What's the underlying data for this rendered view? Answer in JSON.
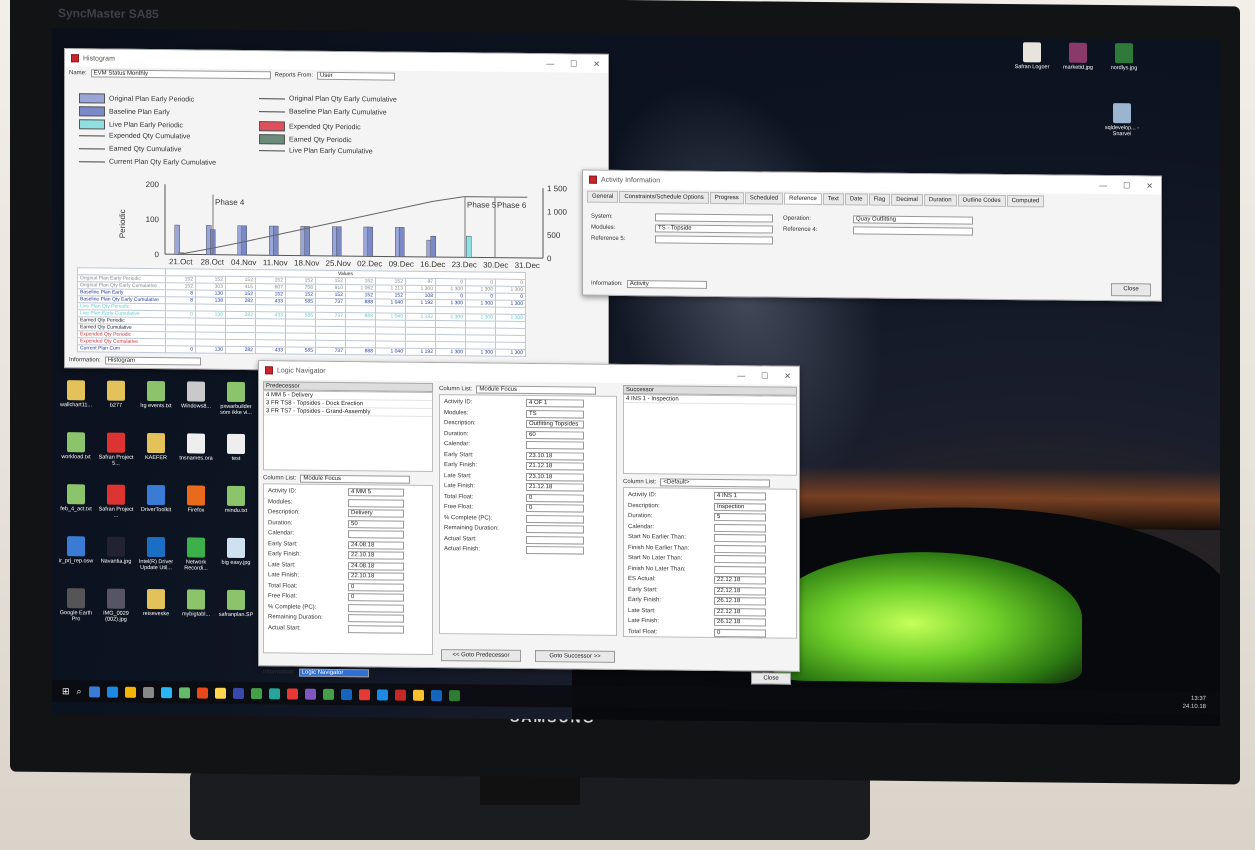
{
  "monitor": {
    "brand": "SyncMaster SA85",
    "maker": "SAMSUNG"
  },
  "histogram": {
    "title": "Histogram",
    "name_label": "Name:",
    "name_value": "EVM Status Monthly",
    "reports_from_label": "Reports From:",
    "reports_from_value": "User",
    "legend": [
      "Original Plan Early Periodic",
      "Baseline Plan Early",
      "Live Plan Early Periodic",
      "Expended Qty Cumulative",
      "Earned Qty Cumulative",
      "Current Plan Qty Early Cumulative",
      "Original Plan Qty Early Cumulative",
      "Baseline Plan Early Cumulative",
      "Expended Qty Periodic",
      "Earned Qty Periodic",
      "Live Plan Early Cumulative"
    ],
    "y_left_label": "Periodic",
    "y_right_label": "Cumulative",
    "phase_labels": [
      "Phase 4",
      "Phase 5",
      "Phase 6"
    ],
    "y_left_ticks": [
      "200",
      "100",
      "0"
    ],
    "y_right_ticks": [
      "1 500",
      "1 000",
      "500",
      "0"
    ],
    "values_header": "Values",
    "table_rows": [
      "Original Plan Early Periodic",
      "Original Plan Qty Early Cumulative",
      "Baseline Plan Early",
      "Baseline Plan Qty Early Cumulative",
      "Live Plan Qty Periodic",
      "Live Plan Early Cumulative",
      "Earned Qty Periodic",
      "Earned Qty Cumulative",
      "Expended Qty Periodic",
      "Expended Qty Cumulative",
      "Current Plan Cum"
    ],
    "table_values": [
      [
        "152",
        "152",
        "152",
        "152",
        "152",
        "152",
        "152",
        "152",
        "87",
        "0",
        "0",
        "0"
      ],
      [
        "152",
        "303",
        "415",
        "607",
        "758",
        "910",
        "1 062",
        "1 213",
        "1 300",
        "1 300",
        "1 300",
        "1 300"
      ],
      [
        "8",
        "130",
        "152",
        "152",
        "152",
        "152",
        "152",
        "152",
        "108",
        "0",
        "0",
        "0"
      ],
      [
        "8",
        "138",
        "282",
        "433",
        "585",
        "737",
        "888",
        "1 040",
        "1 192",
        "1 300",
        "1 300",
        "1 300"
      ],
      [
        "",
        "",
        "",
        "",
        "",
        "",
        "",
        "",
        "",
        "",
        "",
        ""
      ],
      [
        "0",
        "130",
        "282",
        "433",
        "585",
        "737",
        "888",
        "1 040",
        "1 192",
        "1 300",
        "1 300",
        "1 300"
      ],
      [
        "",
        "",
        "",
        "",
        "",
        "",
        "",
        "",
        "",
        "",
        "",
        ""
      ],
      [
        "",
        "",
        "",
        "",
        "",
        "",
        "",
        "",
        "",
        "",
        "",
        ""
      ],
      [
        "",
        "",
        "",
        "",
        "",
        "",
        "",
        "",
        "",
        "",
        "",
        ""
      ],
      [
        "",
        "",
        "",
        "",
        "",
        "",
        "",
        "",
        "",
        "",
        "",
        ""
      ],
      [
        "0",
        "130",
        "282",
        "433",
        "585",
        "737",
        "888",
        "1 040",
        "1 192",
        "1 300",
        "1 300",
        "1 300"
      ]
    ],
    "info_label": "Information:",
    "info_value": "Histogram"
  },
  "chart_data": {
    "type": "bar",
    "categories": [
      "21.Oct",
      "28.Oct",
      "04.Nov",
      "11.Nov",
      "18.Nov",
      "25.Nov",
      "02.Dec",
      "09.Dec",
      "16.Dec",
      "23.Dec",
      "30.Dec",
      "31.Dec"
    ],
    "series": [
      {
        "name": "Original Plan Early Periodic",
        "values": [
          152,
          152,
          152,
          152,
          152,
          152,
          152,
          152,
          87,
          0,
          0,
          0
        ]
      },
      {
        "name": "Baseline Plan Early",
        "values": [
          8,
          130,
          152,
          152,
          152,
          152,
          152,
          152,
          108,
          0,
          0,
          0
        ]
      },
      {
        "name": "Live Plan Early Periodic",
        "values": [
          0,
          0,
          0,
          0,
          0,
          0,
          0,
          0,
          0,
          110,
          0,
          0
        ]
      }
    ],
    "cumulative": [
      8,
      138,
      282,
      433,
      585,
      737,
      888,
      1040,
      1192,
      1300,
      1300,
      1300
    ],
    "ylim": [
      0,
      200
    ],
    "y2lim": [
      0,
      1500
    ],
    "ylabel": "Periodic",
    "y2label": "Cumulative"
  },
  "activity": {
    "title": "Activity Information",
    "tabs": [
      "General",
      "Constraints/Schedule Options",
      "Progress",
      "Scheduled",
      "Reference",
      "Text",
      "Date",
      "Flag",
      "Decimal",
      "Duration",
      "Outline Codes",
      "Computed"
    ],
    "system_label": "System:",
    "system_value": "",
    "modules_label": "Modules:",
    "modules_value": "TS - Topside",
    "reference5_label": "Reference 5:",
    "reference5_value": "",
    "operation_label": "Operation:",
    "operation_value": "Quay Outfitting",
    "reference4_label": "Reference 4:",
    "reference4_value": "",
    "info_label": "Information:",
    "info_value": "Activity",
    "close": "Close"
  },
  "logic": {
    "title": "Logic Navigator",
    "predecessor_header": "Predecessor",
    "predecessors": [
      "4 MM 5 - Delivery",
      "3 FR TS8 - Topsides - Dock Erection",
      "3 FR TS7 - Topsides - Grand-Assembly"
    ],
    "successor_header": "Successor",
    "successors": [
      "4 INS 1 - Inspection"
    ],
    "col_list_label": "Column List:",
    "col_list_value": "Module Focus",
    "col_list_default": "<Default>",
    "pred_fields": [
      [
        "Activity ID:",
        "4 MM 5"
      ],
      [
        "Modules:",
        ""
      ],
      [
        "Description:",
        "Delivery"
      ],
      [
        "Duration:",
        "50"
      ],
      [
        "Calendar:",
        ""
      ],
      [
        "Early Start:",
        "24.08.18"
      ],
      [
        "Early Finish:",
        "22.10.18"
      ],
      [
        "Late Start:",
        "24.08.18"
      ],
      [
        "Late Finish:",
        "22.10.18"
      ],
      [
        "Total Float:",
        "0"
      ],
      [
        "Free Float:",
        "0"
      ],
      [
        "% Complete (PC):",
        ""
      ],
      [
        "Remaining Duration:",
        ""
      ],
      [
        "Actual Start:",
        ""
      ]
    ],
    "center_fields": [
      [
        "Activity ID:",
        "4 OF 1"
      ],
      [
        "Modules:",
        "TS"
      ],
      [
        "Description:",
        "Outfitting Topsides"
      ],
      [
        "Duration:",
        "60"
      ],
      [
        "Calendar:",
        ""
      ],
      [
        "Early Start:",
        "23.10.18"
      ],
      [
        "Early Finish:",
        "21.12.18"
      ],
      [
        "Late Start:",
        "23.10.18"
      ],
      [
        "Late Finish:",
        "21.12.18"
      ],
      [
        "Total Float:",
        "0"
      ],
      [
        "Free Float:",
        "0"
      ],
      [
        "% Complete (PC):",
        ""
      ],
      [
        "Remaining Duration:",
        ""
      ],
      [
        "Actual Start:",
        ""
      ],
      [
        "Actual Finish:",
        ""
      ]
    ],
    "succ_fields": [
      [
        "Activity ID:",
        "4 INS 1"
      ],
      [
        "Description:",
        "Inspection"
      ],
      [
        "Duration:",
        "5"
      ],
      [
        "Calendar:",
        ""
      ],
      [
        "Start No Earlier Than:",
        ""
      ],
      [
        "Finish No Earlier Than:",
        ""
      ],
      [
        "Start No Later Than:",
        ""
      ],
      [
        "Finish No Later Than:",
        ""
      ],
      [
        "ES Actual:",
        "22.12.18"
      ],
      [
        "Early Start:",
        "22.12.18"
      ],
      [
        "Early Finish:",
        "26.12.18"
      ],
      [
        "Late Start:",
        "22.12.18"
      ],
      [
        "Late Finish:",
        "26.12.18"
      ],
      [
        "Total Float:",
        "0"
      ]
    ],
    "goto_pred": "<< Goto Predecessor",
    "goto_succ": "Goto Successor >>",
    "info_label": "Information:",
    "info_value": "Logic Navigator",
    "close": "Close"
  },
  "desktop_icons_top": [
    {
      "label": "Safran Logoer",
      "color": "#e8e3dc"
    },
    {
      "label": "marketid.jpg",
      "color": "#8a3a6a"
    },
    {
      "label": "nordlys.jpg",
      "color": "#2f7a3a"
    },
    {
      "label": "sqldevelop... - Snarvei",
      "color": "#9bb4d0"
    }
  ],
  "desktop_icons": [
    {
      "label": "wallchart11...",
      "color": "#e3c25a"
    },
    {
      "label": "b277",
      "color": "#e3c25a"
    },
    {
      "label": "lrg events.txt",
      "color": "#8bc46a"
    },
    {
      "label": "Windows8...",
      "color": "#c9c9c9"
    },
    {
      "label": "pxwarbuilder som ikke vi...",
      "color": "#8bc46a"
    },
    {
      "label": "workload.txt",
      "color": "#8bc46a"
    },
    {
      "label": "Safran Project 5...",
      "color": "#d33"
    },
    {
      "label": "KAEFER",
      "color": "#e3c25a"
    },
    {
      "label": "tnsnames.ora",
      "color": "#eee"
    },
    {
      "label": "test",
      "color": "#eee"
    },
    {
      "label": "feb_4_act.txt",
      "color": "#8bc46a"
    },
    {
      "label": "Safran Project ...",
      "color": "#d33"
    },
    {
      "label": "DriverToolkit",
      "color": "#3a7bd5"
    },
    {
      "label": "Firefox",
      "color": "#e86a1a"
    },
    {
      "label": "mindu.txt",
      "color": "#8bc46a"
    },
    {
      "label": "ir_prj_rep.osw",
      "color": "#3a7bd5"
    },
    {
      "label": "Navantia.jpg",
      "color": "#223"
    },
    {
      "label": "Intel(R) Driver Update Util...",
      "color": "#1a6fc4"
    },
    {
      "label": "Network Recordi...",
      "color": "#3cb04a"
    },
    {
      "label": "big easy.jpg",
      "color": "#cfe0f0"
    },
    {
      "label": "Google Earth Pro",
      "color": "#555"
    },
    {
      "label": "IMG_0029 (002).jpg",
      "color": "#556"
    },
    {
      "label": "reiseveske",
      "color": "#e3c25a"
    },
    {
      "label": "mybigtabl...",
      "color": "#8bc46a"
    },
    {
      "label": "safranplan.SP",
      "color": "#8bc46a"
    }
  ],
  "taskbar_colors": [
    "#3a7bd5",
    "#1e88e5",
    "#f4b400",
    "#888",
    "#29b6f6",
    "#66bb6a",
    "#e64a19",
    "#ffd54f",
    "#3949ab",
    "#43a047",
    "#26a69a",
    "#e53935",
    "#7e57c2",
    "#43a047",
    "#1565c0",
    "#e53935",
    "#1e88e5",
    "#c62828",
    "#fbc02d",
    "#1565c0",
    "#2e7d32"
  ],
  "clock": {
    "time": "13:37",
    "date": "24.10.18"
  }
}
